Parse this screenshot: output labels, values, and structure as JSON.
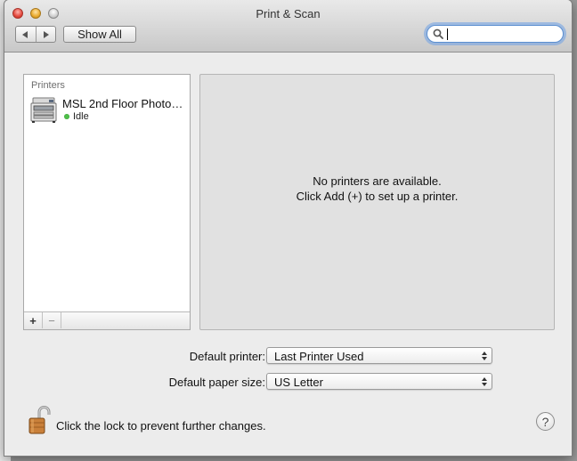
{
  "window": {
    "title": "Print & Scan",
    "show_all_label": "Show All",
    "search": {
      "value": "",
      "placeholder": ""
    }
  },
  "printers": {
    "header": "Printers",
    "items": [
      {
        "name": "MSL 2nd Floor Photo…",
        "status": "Idle",
        "status_color": "#4fbf4a"
      }
    ],
    "add_label": "+",
    "remove_label": "−"
  },
  "detail": {
    "line1": "No printers are available.",
    "line2": "Click Add (+) to set up a printer."
  },
  "settings": {
    "default_printer_label": "Default printer:",
    "default_printer_value": "Last Printer Used",
    "default_paper_label": "Default paper size:",
    "default_paper_value": "US Letter"
  },
  "footer": {
    "lock_text": "Click the lock to prevent further changes.",
    "help_label": "?"
  }
}
